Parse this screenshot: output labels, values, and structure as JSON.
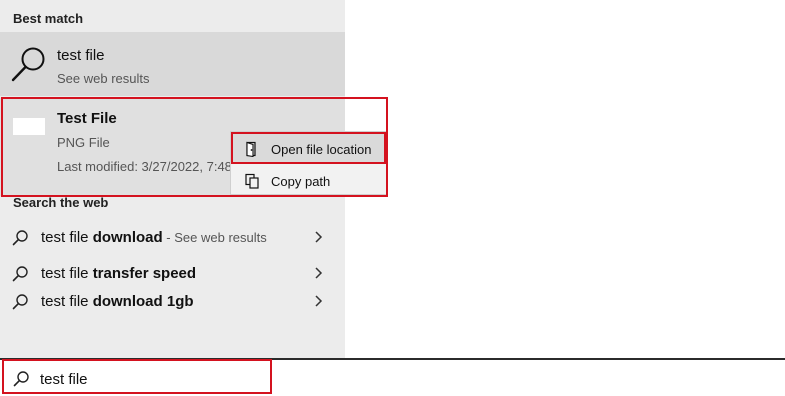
{
  "best_match": {
    "header": "Best match",
    "web_result": {
      "title": "test file",
      "subtitle": "See web results",
      "icon": "search-icon"
    },
    "file_result": {
      "title": "Test File",
      "type": "PNG File",
      "modified": "Last modified: 3/27/2022, 7:48",
      "icon": "image-thumbnail"
    }
  },
  "context_menu": {
    "items": [
      {
        "label": "Open file location",
        "icon": "folder-location-icon"
      },
      {
        "label": "Copy path",
        "icon": "copy-icon"
      }
    ]
  },
  "search_the_web": {
    "header": "Search the web",
    "items": [
      {
        "prefix": "test file ",
        "bold": "download",
        "suffix": " - See web results"
      },
      {
        "prefix": "test file ",
        "bold": "transfer speed",
        "suffix": ""
      },
      {
        "prefix": "test file ",
        "bold": "download 1gb",
        "suffix": ""
      }
    ]
  },
  "search_bar": {
    "value": "test file"
  },
  "colors": {
    "highlight_box": "#d4121f",
    "panel_bg": "#ececec",
    "selected_bg": "#d9d9d9"
  }
}
